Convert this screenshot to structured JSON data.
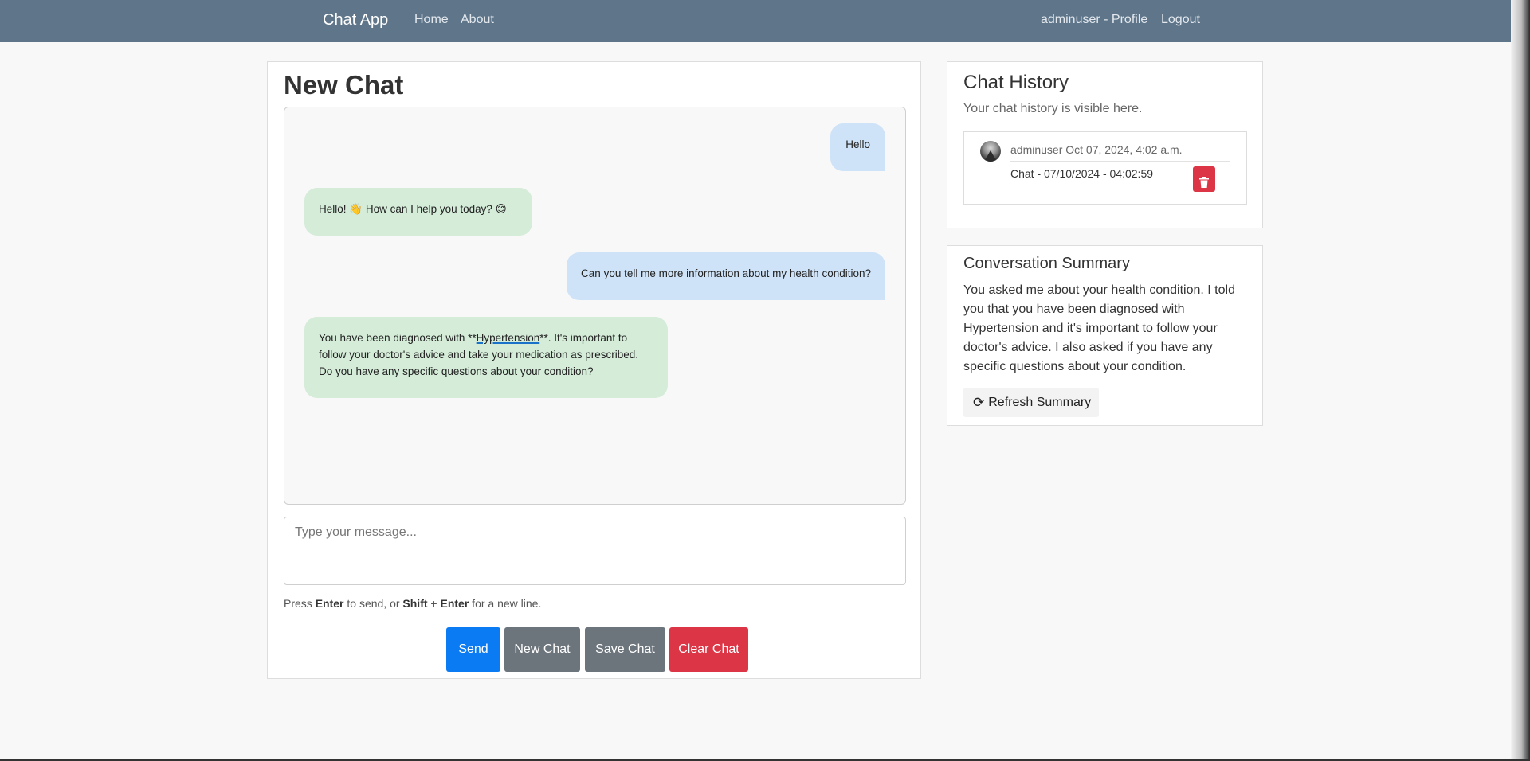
{
  "navbar": {
    "brand": "Chat App",
    "links": [
      "Home",
      "About"
    ],
    "profile": "adminuser - Profile",
    "logout": "Logout"
  },
  "chat": {
    "title": "New Chat",
    "messages": [
      {
        "role": "user",
        "text": "Hello"
      },
      {
        "role": "bot",
        "text": "Hello! 👋 How can I help you today? 😊"
      },
      {
        "role": "user",
        "text": "Can you tell me more information about my health condition?"
      },
      {
        "role": "bot",
        "pre": "You have been diagnosed with **",
        "highlight": "Hypertension",
        "post": "**. It's important to follow your doctor's advice and take your medication as prescribed. Do you have any specific questions about your condition?"
      }
    ],
    "input_placeholder": "Type your message...",
    "input_value": "",
    "hint": {
      "t1": "Press ",
      "k1": "Enter",
      "t2": " to send, or ",
      "k2": "Shift",
      "t3": " + ",
      "k3": "Enter",
      "t4": " for a new line."
    },
    "buttons": {
      "send": "Send",
      "new": "New Chat",
      "save": "Save Chat",
      "clear": "Clear Chat"
    }
  },
  "history": {
    "title": "Chat History",
    "subtitle": "Your chat history is visible here.",
    "items": [
      {
        "meta": "adminuser Oct 07, 2024, 4:02 a.m.",
        "label": "Chat - 07/10/2024 - 04:02:59",
        "icon": "trash-icon"
      }
    ]
  },
  "summary": {
    "title": "Conversation Summary",
    "text": "You asked me about your health condition. I told you that you have been diagnosed with Hypertension and it's important to follow your doctor's advice. I also asked if you have any specific questions about your condition.",
    "refresh_label": "Refresh Summary",
    "refresh_icon": "refresh-icon"
  },
  "colors": {
    "navbar": "#5f768a",
    "user_bubble": "#cfe3f8",
    "bot_bubble": "#d4ecd8",
    "primary": "#0a7bf3",
    "secondary": "#6c747c",
    "danger": "#dc3545"
  }
}
